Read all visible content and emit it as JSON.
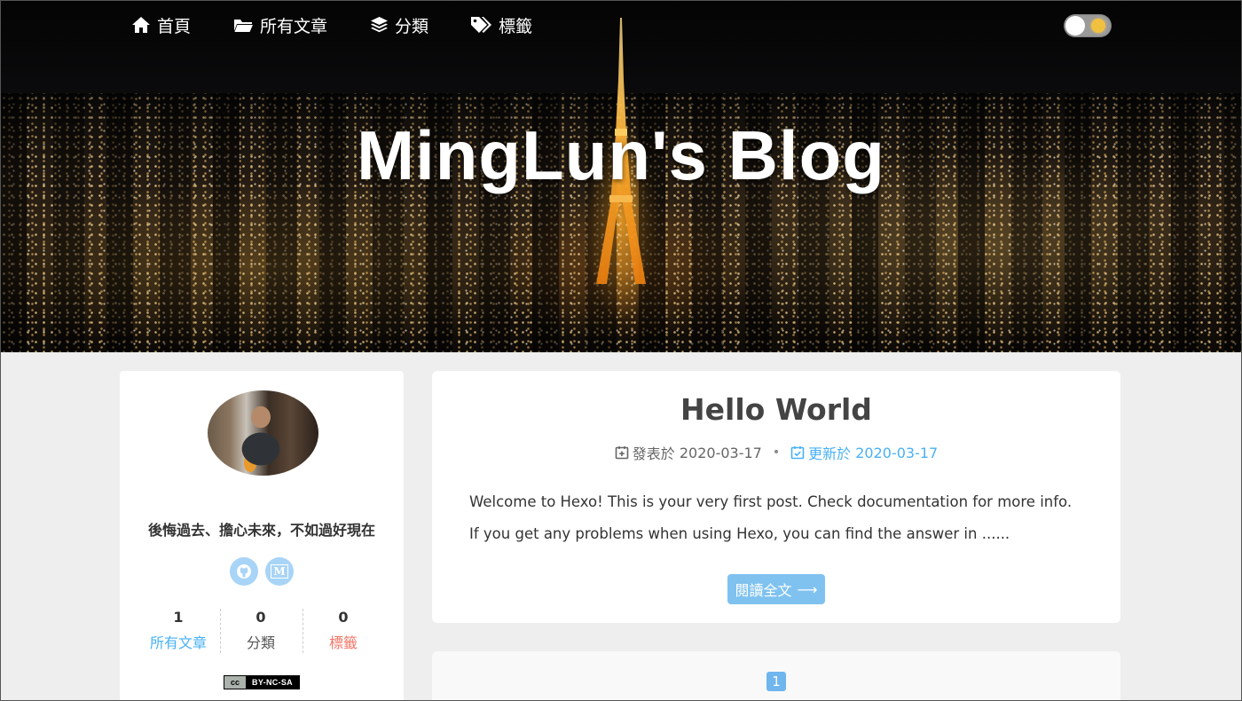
{
  "nav": {
    "items": [
      {
        "label": "首頁",
        "icon": "home-icon"
      },
      {
        "label": "所有文章",
        "icon": "folder-open-icon"
      },
      {
        "label": "分類",
        "icon": "layers-icon"
      },
      {
        "label": "標籤",
        "icon": "tags-icon"
      }
    ],
    "theme_toggle": {
      "state": "light",
      "icon": "sun-icon"
    }
  },
  "hero": {
    "title": "MingLun's Blog"
  },
  "sidebar": {
    "motto": "後悔過去、擔心未來，不如過好現在",
    "social": [
      {
        "icon": "github-icon"
      },
      {
        "icon": "medium-icon",
        "glyph": "M"
      }
    ],
    "stats": [
      {
        "count": "1",
        "label": "所有文章"
      },
      {
        "count": "0",
        "label": "分類"
      },
      {
        "count": "0",
        "label": "標籤"
      }
    ],
    "license": {
      "left": "cc",
      "right": "BY-NC-SA"
    }
  },
  "post": {
    "title": "Hello World",
    "published_label": "發表於",
    "published_date": "2020-03-17",
    "meta_separator": "•",
    "updated_label": "更新於",
    "updated_date": "2020-03-17",
    "excerpt": "Welcome to Hexo! This is your very first post. Check documentation for more info. If you get any problems when using Hexo, you can find the answer in ......",
    "read_more": "閱讀全文",
    "read_more_arrow": "⟶"
  },
  "pagination": {
    "current_page": "1"
  },
  "colors": {
    "accent": "#49b1f5",
    "tags_label": "#f47466",
    "page_bg": "#eeeeee"
  }
}
